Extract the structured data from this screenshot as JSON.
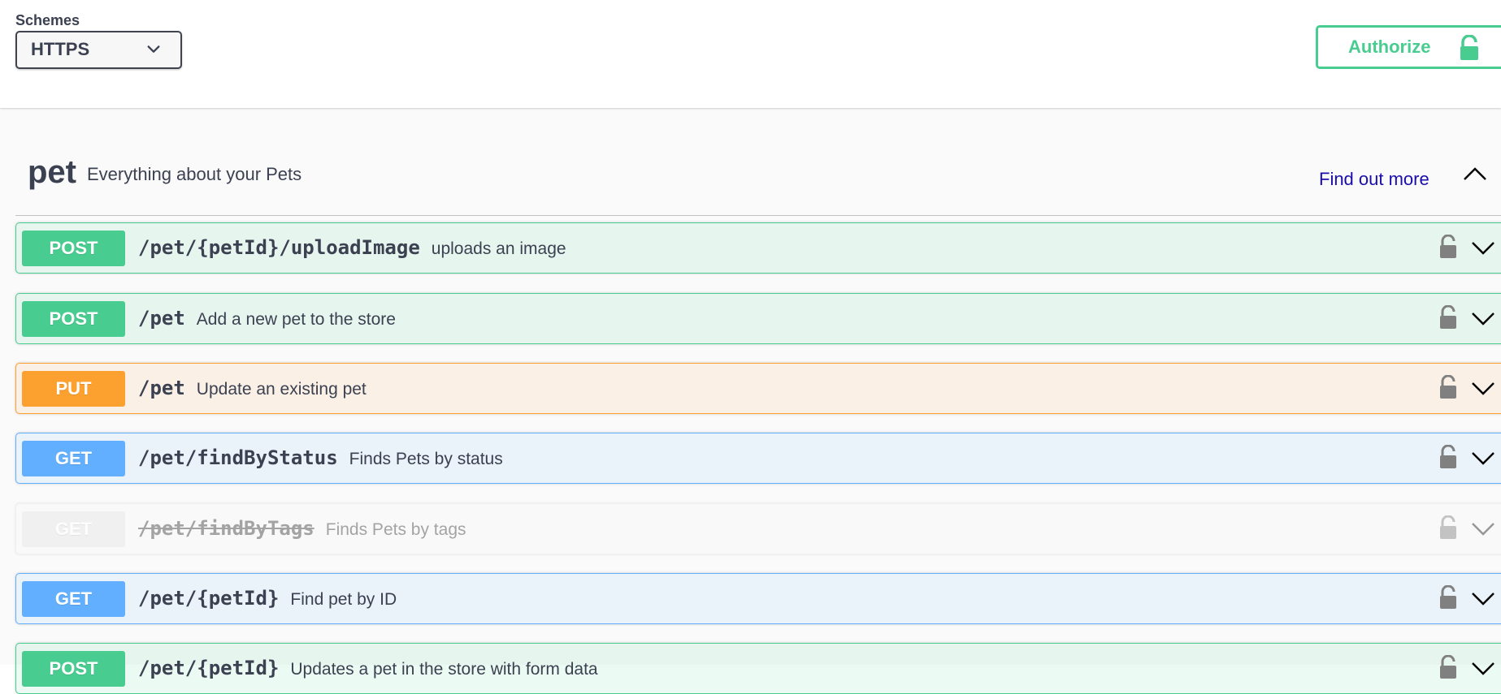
{
  "schemes": {
    "label": "Schemes",
    "selected": "HTTPS"
  },
  "authorize": {
    "label": "Authorize"
  },
  "tag": {
    "name": "pet",
    "description": "Everything about your Pets",
    "link": "Find out more"
  },
  "colors": {
    "post": "#49cc90",
    "put": "#fca130",
    "get": "#61affe",
    "deprecated": "#ebebeb"
  },
  "operations": [
    {
      "method": "POST",
      "path": "/pet/{petId}/uploadImage",
      "summary": "uploads an image",
      "deprecated": false
    },
    {
      "method": "POST",
      "path": "/pet",
      "summary": "Add a new pet to the store",
      "deprecated": false
    },
    {
      "method": "PUT",
      "path": "/pet",
      "summary": "Update an existing pet",
      "deprecated": false
    },
    {
      "method": "GET",
      "path": "/pet/findByStatus",
      "summary": "Finds Pets by status",
      "deprecated": false
    },
    {
      "method": "GET",
      "path": "/pet/findByTags",
      "summary": "Finds Pets by tags",
      "deprecated": true
    },
    {
      "method": "GET",
      "path": "/pet/{petId}",
      "summary": "Find pet by ID",
      "deprecated": false
    },
    {
      "method": "POST",
      "path": "/pet/{petId}",
      "summary": "Updates a pet in the store with form data",
      "deprecated": false
    }
  ]
}
